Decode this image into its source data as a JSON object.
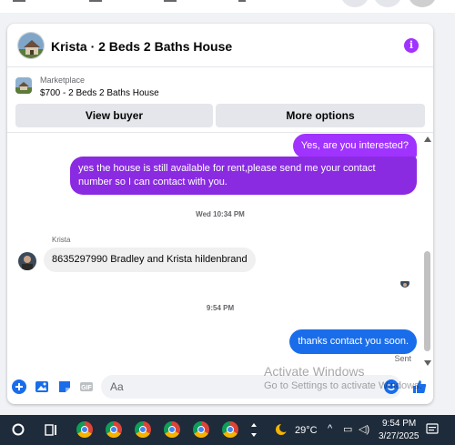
{
  "chat": {
    "title": "Krista · 2 Beds 2 Baths House",
    "info_icon": "i"
  },
  "marketplace": {
    "label": "Marketplace",
    "listing": "$700 - 2 Beds 2 Baths House",
    "view_buyer": "View buyer",
    "more_options": "More options"
  },
  "messages": {
    "m1": "Yes, are you interested?",
    "m2": "yes the house is still available for rent,please send me your contact number so I can contact with you.",
    "stamp1": "Wed 10:34 PM",
    "sender": "Krista",
    "m3": "8635297990 Bradley and Krista hildenbrand",
    "stamp2": "9:54 PM",
    "m4": "thanks contact you soon.",
    "sent": "Sent"
  },
  "composer": {
    "placeholder": "Aa"
  },
  "watermark": {
    "line1": "Activate Windows",
    "line2": "Go to Settings to activate Windows."
  },
  "taskbar": {
    "weather": "29°C",
    "time": "9:54 PM",
    "date": "3/27/2025"
  },
  "colors": {
    "accent_purple": "#a033ff",
    "bubble_violet": "#8a2be2",
    "bubble_blue": "#1a6dea",
    "taskbar": "#1e2b3a"
  }
}
